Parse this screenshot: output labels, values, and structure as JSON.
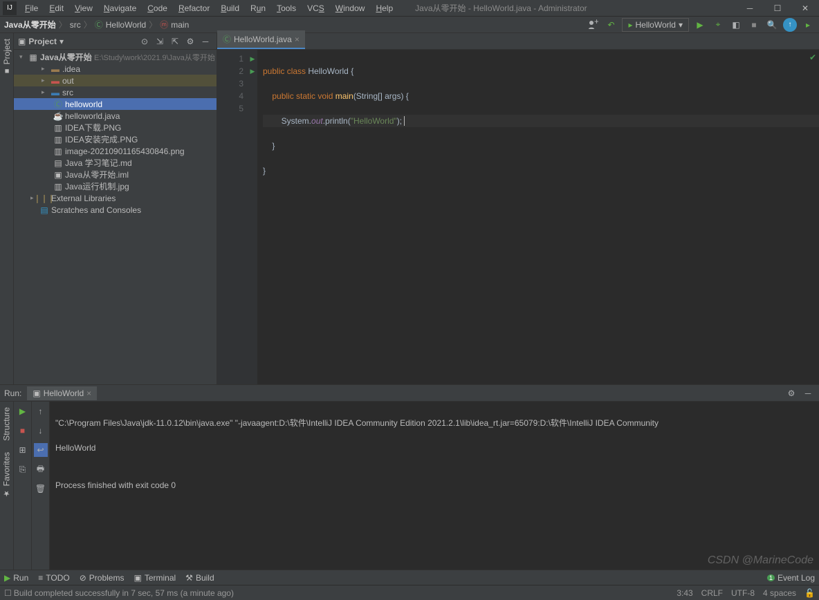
{
  "window": {
    "title": "Java从零开始 - HelloWorld.java - Administrator",
    "menu": [
      "File",
      "Edit",
      "View",
      "Navigate",
      "Code",
      "Refactor",
      "Build",
      "Run",
      "Tools",
      "VCS",
      "Window",
      "Help"
    ]
  },
  "breadcrumb": {
    "items": [
      "Java从零开始",
      "src",
      "HelloWorld",
      "main"
    ]
  },
  "run_config": {
    "name": "HelloWorld"
  },
  "project": {
    "panel_title": "Project",
    "root": {
      "name": "Java从零开始",
      "path": "E:\\Study\\work\\2021.9\\Java从零开始"
    },
    "items": [
      {
        "name": ".idea",
        "type": "folder",
        "indent": 2
      },
      {
        "name": "out",
        "type": "folder-out",
        "indent": 2
      },
      {
        "name": "src",
        "type": "folder-src",
        "indent": 2
      },
      {
        "name": "helloworld",
        "type": "class",
        "indent": 3,
        "selected": true
      },
      {
        "name": "helloworld.java",
        "type": "java",
        "indent": 3
      },
      {
        "name": "IDEA下载.PNG",
        "type": "img",
        "indent": 3
      },
      {
        "name": "IDEA安装完成.PNG",
        "type": "img",
        "indent": 3
      },
      {
        "name": "image-20210901165430846.png",
        "type": "img",
        "indent": 3
      },
      {
        "name": "Java 学习笔记.md",
        "type": "md",
        "indent": 3
      },
      {
        "name": "Java从零开始.iml",
        "type": "iml",
        "indent": 3
      },
      {
        "name": "Java运行机制.jpg",
        "type": "img",
        "indent": 3
      }
    ],
    "ext_lib": "External Libraries",
    "scratches": "Scratches and Consoles"
  },
  "editor": {
    "tab": "HelloWorld.java",
    "lines": [
      "1",
      "2",
      "3",
      "4",
      "5",
      ""
    ],
    "tokens": {
      "l1_kw1": "public",
      "l1_kw2": "class",
      "l1_cls": "HelloWorld",
      "l1_brace": " {",
      "l2_kw1": "public",
      "l2_kw2": "static",
      "l2_kw3": "void",
      "l2_fn": "main",
      "l2_sig": "(String[] args) {",
      "l3_sys": "System.",
      "l3_out": "out",
      "l3_pr": ".println(",
      "l3_str": "\"HelloWorld\"",
      "l3_end": ");",
      "l4": "}",
      "l5": "}"
    }
  },
  "run_panel": {
    "title": "Run:",
    "tab": "HelloWorld",
    "console_lines": [
      "\"C:\\Program Files\\Java\\jdk-11.0.12\\bin\\java.exe\" \"-javaagent:D:\\软件\\IntelliJ IDEA Community Edition 2021.2.1\\lib\\idea_rt.jar=65079:D:\\软件\\IntelliJ IDEA Community",
      "HelloWorld",
      "",
      "Process finished with exit code 0"
    ]
  },
  "bottom": {
    "run": "Run",
    "todo": "TODO",
    "problems": "Problems",
    "terminal": "Terminal",
    "build": "Build",
    "event_log": "Event Log"
  },
  "status": {
    "msg": "Build completed successfully in 7 sec, 57 ms (a minute ago)",
    "pos": "3:43",
    "crlf": "CRLF",
    "enc": "UTF-8",
    "indent": "4 spaces"
  },
  "left_tabs": {
    "project": "Project",
    "structure": "Structure",
    "favorites": "Favorites"
  },
  "watermark": "CSDN @MarineCode"
}
